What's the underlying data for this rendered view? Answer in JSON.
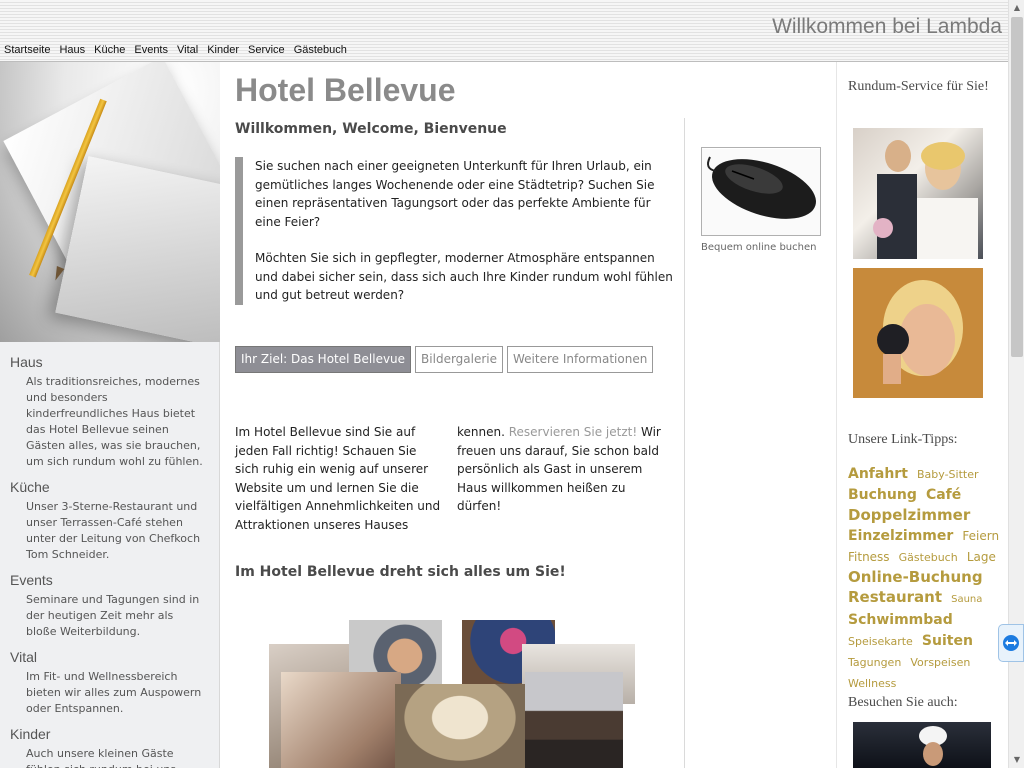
{
  "header": {
    "welcome": "Willkommen bei Lambda",
    "nav": [
      "Startseite",
      "Haus",
      "Küche",
      "Events",
      "Vital",
      "Kinder",
      "Service",
      "Gästebuch"
    ]
  },
  "left": {
    "items": [
      {
        "title": "Haus",
        "text": "Als traditionsreiches, modernes und besonders kinderfreundliches Haus bietet das Hotel Bellevue seinen Gästen alles, was sie brauchen, um sich rundum wohl zu fühlen."
      },
      {
        "title": "Küche",
        "text": "Unser 3-Sterne-Restaurant und unser Terrassen-Café stehen unter der Leitung von Chefkoch Tom Schneider."
      },
      {
        "title": "Events",
        "text": "Seminare und Tagungen sind in der heutigen Zeit mehr als bloße Weiterbildung."
      },
      {
        "title": "Vital",
        "text": "Im Fit- und Wellnessbereich bieten wir alles zum Auspowern oder Entspannen."
      },
      {
        "title": "Kinder",
        "text": "Auch unsere kleinen Gäste fühlen sich rundum bei uns wohl."
      }
    ]
  },
  "main": {
    "title": "Hotel Bellevue",
    "subtitle": "Willkommen, Welcome, Bienvenue",
    "quote_p1": "Sie suchen nach einer geeigneten Unterkunft für Ihren Urlaub, ein gemütliches langes Wochenende oder eine Städtetrip? Suchen Sie einen repräsentativen Tagungsort oder das perfekte Ambiente für eine Feier?",
    "quote_p2": "Möchten Sie sich in gepflegter, moderner Atmosphäre entspannen und dabei sicher sein, dass sich auch Ihre Kinder rundum wohl fühlen und gut betreut werden?",
    "image_caption": "Bequem online buchen",
    "tabs": [
      "Ihr Ziel: Das Hotel Bellevue",
      "Bildergalerie",
      "Weitere Informationen"
    ],
    "body_before": "Im Hotel Bellevue sind Sie auf jeden Fall richtig! Schauen Sie sich ruhig ein wenig auf unserer Website um und lernen Sie die vielfältigen Annehmlichkeiten und Attraktionen unseres Hauses kennen. ",
    "body_link": "Reservieren Sie jetzt!",
    "body_after": " Wir freuen uns darauf, Sie schon bald persönlich als Gast in unserem Haus willkommen heißen zu dürfen!",
    "heading2": "Im Hotel Bellevue dreht sich alles um Sie!"
  },
  "right": {
    "service_heading": "Rundum-Service für Sie!",
    "links_heading": "Unsere Link-Tipps:",
    "tags": [
      {
        "text": "Anfahrt",
        "size": "large"
      },
      {
        "text": "Baby-Sitter",
        "size": "small"
      },
      {
        "text": "Buchung",
        "size": "large"
      },
      {
        "text": "Café",
        "size": "large"
      },
      {
        "text": "Doppelzimmer",
        "size": "xlarge"
      },
      {
        "text": "Einzelzimmer",
        "size": "large"
      },
      {
        "text": "Feiern",
        "size": "medium"
      },
      {
        "text": "Fitness",
        "size": "medium"
      },
      {
        "text": "Gästebuch",
        "size": "small"
      },
      {
        "text": "Lage",
        "size": "medium"
      },
      {
        "text": "Online-Buchung",
        "size": "xlarge"
      },
      {
        "text": "Restaurant",
        "size": "xlarge"
      },
      {
        "text": "Sauna",
        "size": "xsmall"
      },
      {
        "text": "Schwimmbad",
        "size": "large"
      },
      {
        "text": "Speisekarte",
        "size": "small"
      },
      {
        "text": "Suiten",
        "size": "large"
      },
      {
        "text": "Tagungen",
        "size": "small"
      },
      {
        "text": "Vorspeisen",
        "size": "small"
      },
      {
        "text": "Wellness",
        "size": "small"
      }
    ],
    "visit_heading": "Besuchen Sie auch:"
  },
  "colors": {
    "tag_color": "#b59b3e",
    "active_tab_bg": "#8e8e95",
    "left_bg": "#eff0f2"
  }
}
